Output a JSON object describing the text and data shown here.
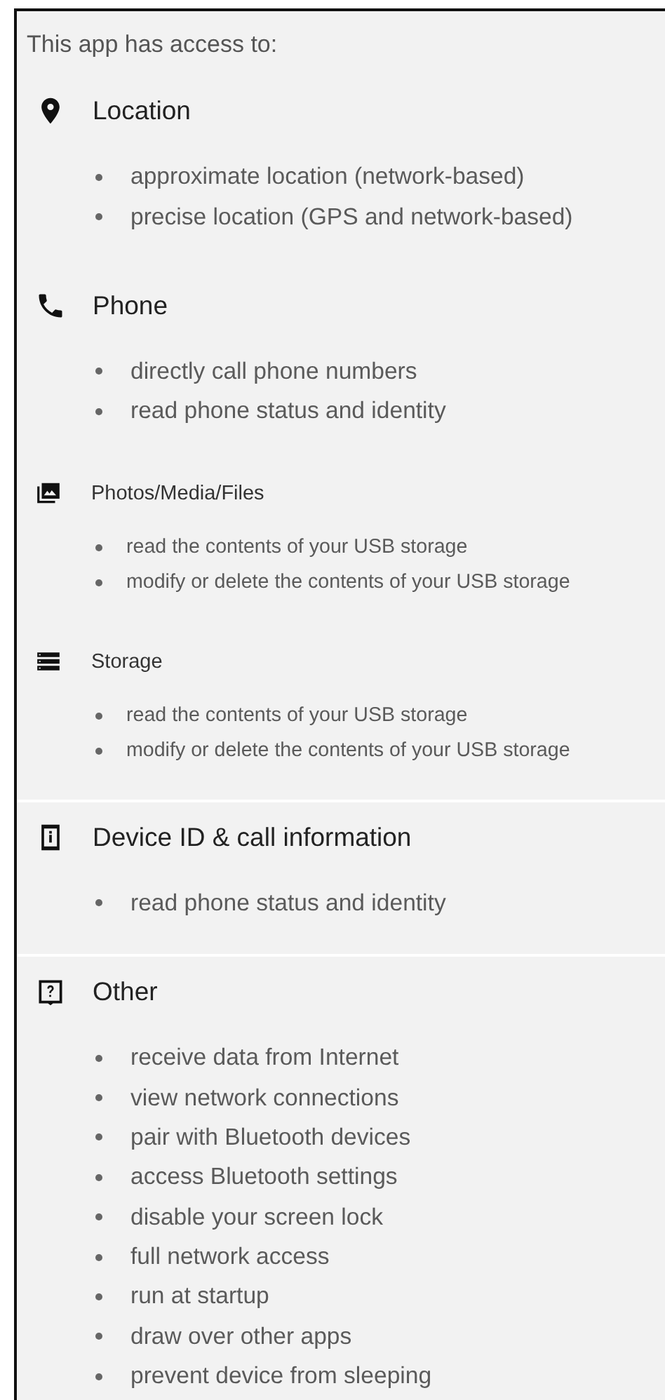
{
  "title": "This app has access to:",
  "sections": [
    {
      "kind": "large",
      "name": "Location",
      "divider": false,
      "items": [
        "approximate location (network-based)",
        "precise location (GPS and network-based)"
      ]
    },
    {
      "kind": "large",
      "name": "Phone",
      "divider": false,
      "items": [
        "directly call phone numbers",
        "read phone status and identity"
      ]
    },
    {
      "kind": "small",
      "name": "Photos/Media/Files",
      "divider": false,
      "items": [
        "read the contents of your USB storage",
        "modify or delete the contents of your USB storage"
      ]
    },
    {
      "kind": "small",
      "name": "Storage",
      "divider": true,
      "items": [
        "read the contents of your USB storage",
        "modify or delete the contents of your USB storage"
      ]
    },
    {
      "kind": "large",
      "name": "Device ID & call information",
      "divider": true,
      "items": [
        "read phone status and identity"
      ]
    },
    {
      "kind": "large",
      "name": "Other",
      "items": [
        "receive data from Internet",
        "view network connections",
        "pair with Bluetooth devices",
        "access Bluetooth settings",
        "disable your screen lock",
        "full network access",
        "run at startup",
        "draw over other apps",
        "prevent device from sleeping"
      ]
    }
  ]
}
